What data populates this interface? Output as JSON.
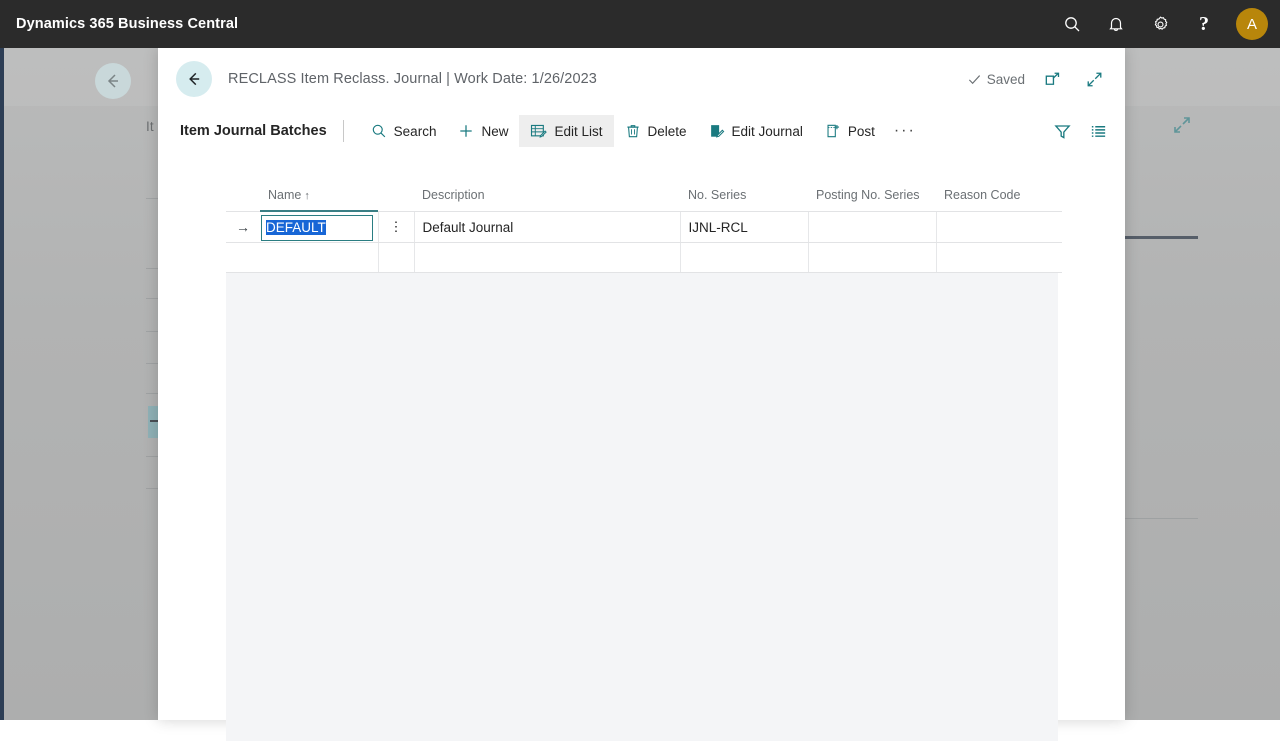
{
  "topbar": {
    "app_title": "Dynamics 365 Business Central",
    "search_icon": "search-icon",
    "notifications_icon": "bell-icon",
    "settings_icon": "gear-icon",
    "help_label": "?",
    "avatar_initial": "A",
    "avatar_color": "#b8860b",
    "background_color": "#2b2b2b"
  },
  "dialog": {
    "back_label": "Back",
    "title": "RECLASS Item Reclass. Journal | Work Date: 1/26/2023",
    "saved_label": "Saved",
    "saved_icon": "checkmark-icon",
    "open_new_window_icon": "open-in-new-window-icon",
    "expand_icon": "expand-diagonal-icon",
    "accent_color": "#2a7d82"
  },
  "commandbar": {
    "heading": "Item Journal Batches",
    "buttons": [
      {
        "label": "Search",
        "icon": "search-icon",
        "active": false
      },
      {
        "label": "New",
        "icon": "plus-icon",
        "active": false
      },
      {
        "label": "Edit List",
        "icon": "edit-list-icon",
        "active": true
      },
      {
        "label": "Delete",
        "icon": "trash-icon",
        "active": false
      },
      {
        "label": "Edit Journal",
        "icon": "edit-journal-icon",
        "active": false
      },
      {
        "label": "Post",
        "icon": "post-icon",
        "active": false
      }
    ],
    "more_label": "···",
    "filter_icon": "filter-funnel-icon",
    "list_icon": "list-view-icon"
  },
  "grid": {
    "columns": [
      {
        "label": "Name",
        "sort": "↑"
      },
      {
        "label": "Description",
        "sort": ""
      },
      {
        "label": "No. Series",
        "sort": ""
      },
      {
        "label": "Posting No. Series",
        "sort": ""
      },
      {
        "label": "Reason Code",
        "sort": ""
      }
    ],
    "rows": [
      {
        "selected": true,
        "row_arrow": "→",
        "menu_glyph": "⋮",
        "name": "DEFAULT",
        "description": "Default Journal",
        "no_series": "IJNL-RCL",
        "posting_no_series": "",
        "reason_code": ""
      },
      {
        "selected": false,
        "row_arrow": "",
        "menu_glyph": "",
        "name": "",
        "description": "",
        "no_series": "",
        "posting_no_series": "",
        "reason_code": ""
      }
    ]
  },
  "backdrop": {
    "title_fragment": "It",
    "back_label": "Back",
    "expand_icon": "expand-diagonal-icon"
  }
}
